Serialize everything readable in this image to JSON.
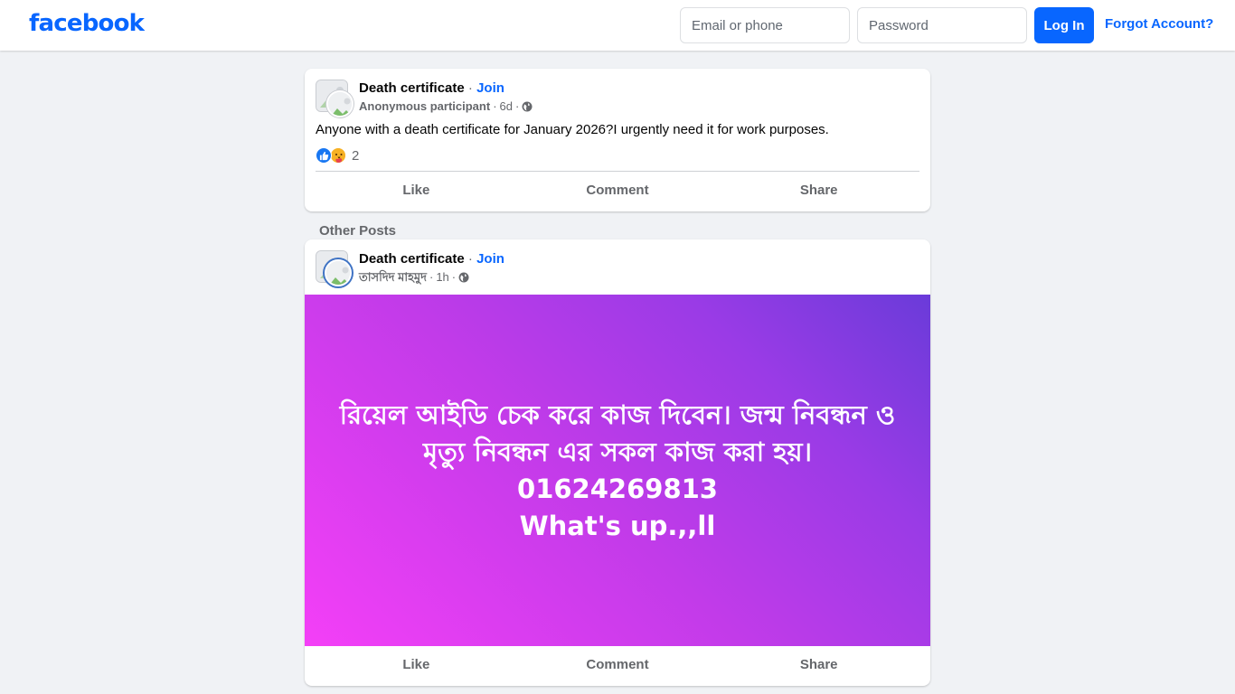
{
  "header": {
    "logo_text": "facebook",
    "email_placeholder": "Email or phone",
    "password_placeholder": "Password",
    "login_label": "Log In",
    "forgot_label": "Forgot Account?"
  },
  "main_post": {
    "group_name": "Death certificate",
    "separator": "·",
    "join_label": "Join",
    "poster": "Anonymous participant",
    "time": "6d",
    "text": "Anyone with a death certificate for January 2026?I urgently need it for work purposes.",
    "reaction_count": "2",
    "reaction_icons": [
      "like-icon",
      "care-icon"
    ],
    "audience_icon": "globe-icon"
  },
  "other_posts_label": "Other Posts",
  "other_post": {
    "group_name": "Death certificate",
    "separator": "·",
    "join_label": "Join",
    "poster": "তাসদিদ মাহমুদ",
    "time": "1h",
    "audience_icon": "globe-icon",
    "background_colors": [
      "#f43ff7",
      "#6a3bd9"
    ],
    "text_lines": [
      "রিয়েল আইডি চেক করে কাজ দিবেন। জন্ম নিবন্ধন ও মৃত্যু নিবন্ধন এর সকল কাজ করা হয়।",
      "01624269813",
      "What's up.,,ll"
    ]
  },
  "actions": {
    "like": "Like",
    "comment": "Comment",
    "share": "Share"
  },
  "colors": {
    "brand_blue": "#0866ff",
    "page_background": "#f0f2f5",
    "secondary_text": "#65676b"
  }
}
